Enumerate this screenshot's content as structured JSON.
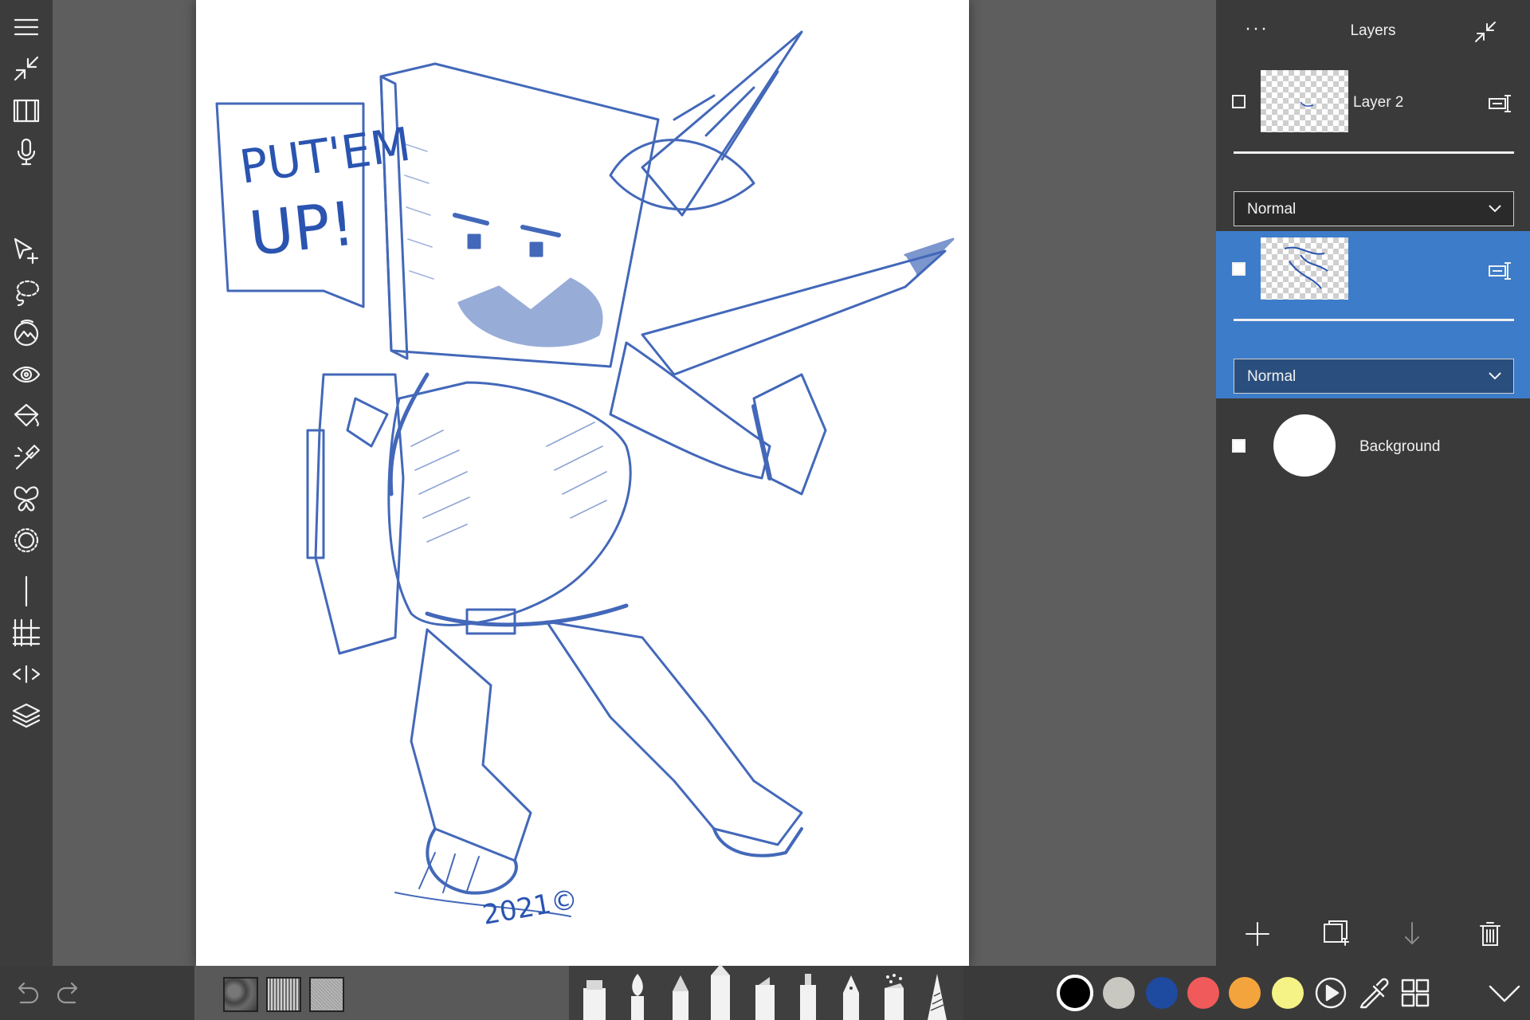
{
  "layers_panel": {
    "title": "Layers",
    "more_label": "···",
    "layers": [
      {
        "name": "Layer 2",
        "visible": false,
        "selected": false,
        "blend_mode": "Normal"
      },
      {
        "name": "",
        "visible": true,
        "selected": true,
        "blend_mode": "Normal"
      },
      {
        "name": "Background",
        "visible": true,
        "selected": false
      }
    ]
  },
  "canvas": {
    "speech_text_line1": "PUT'EM",
    "speech_text_line2": "UP!",
    "signature": "2021©"
  },
  "colors": {
    "swatches": [
      "#000000",
      "#c8c8c0",
      "#1e4aa0",
      "#f05a5a",
      "#f4a43c",
      "#f6f386"
    ],
    "accent": "#3d7cc9"
  },
  "left_toolbar": {
    "icons": [
      "menu-icon",
      "collapse-icon",
      "book-icon",
      "microphone-icon",
      "transform-icon",
      "lasso-icon",
      "image-adjust-icon",
      "eye-icon",
      "fill-icon",
      "magic-wand-icon",
      "symmetry-icon",
      "perspective-icon",
      "ruler-icon",
      "grid-icon",
      "flip-icon",
      "layers-icon"
    ]
  }
}
